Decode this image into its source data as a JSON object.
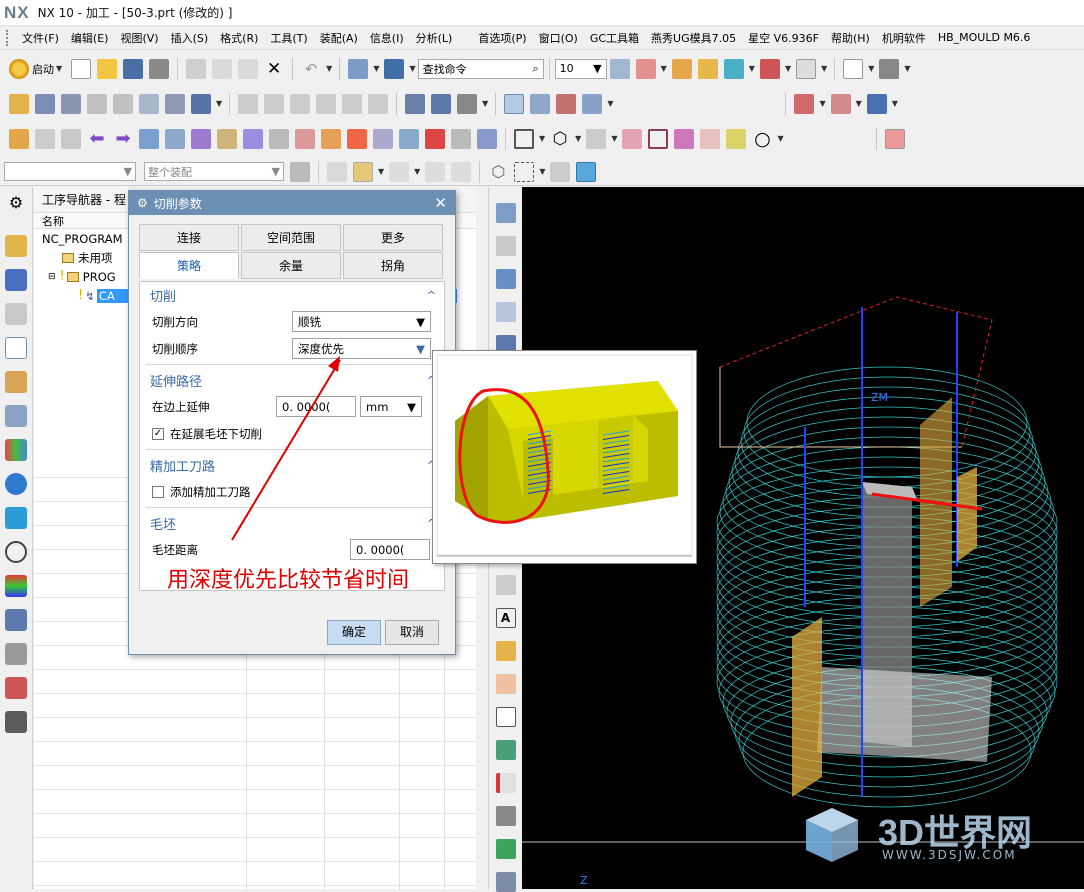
{
  "titlebar": {
    "logo": "NX",
    "title": "NX 10 - 加工 - [50-3.prt  (修改的) ]"
  },
  "menu": [
    "文件(F)",
    "编辑(E)",
    "视图(V)",
    "插入(S)",
    "格式(R)",
    "工具(T)",
    "装配(A)",
    "信息(I)",
    "分析(L)",
    "首选项(P)",
    "窗口(O)",
    "GC工具箱",
    "燕秀UG模具7.05",
    "星空 V6.936F",
    "帮助(H)",
    "机明软件",
    "HB_MOULD M6.6"
  ],
  "toolbar": {
    "start_label": "启动",
    "search_placeholder": "查找命令",
    "grid_value": "10"
  },
  "filter": {
    "assembly_placeholder": "整个装配"
  },
  "navigator": {
    "title": "工序导航器 - 程",
    "column_name": "名称",
    "rows": [
      "NC_PROGRAM",
      "未用项",
      "PROG",
      "CA"
    ]
  },
  "dialog": {
    "title": "切削参数",
    "tabs_top": [
      "连接",
      "空间范围",
      "更多"
    ],
    "tabs_bottom": [
      "策略",
      "余量",
      "拐角"
    ],
    "sections": {
      "cut": "切削",
      "extend": "延伸路径",
      "finish": "精加工刀路",
      "blank": "毛坯"
    },
    "fields": {
      "cut_direction_label": "切削方向",
      "cut_direction_value": "顺铣",
      "cut_order_label": "切削顺序",
      "cut_order_value": "深度优先",
      "extend_edge_label": "在边上延伸",
      "extend_edge_value": "0. 0000(",
      "extend_edge_unit": "mm",
      "extend_under_blank_label": "在延展毛坯下切削",
      "add_finish_label": "添加精加工刀路",
      "blank_distance_label": "毛坯距离",
      "blank_distance_value": "0. 0000("
    },
    "ok_label": "确定",
    "cancel_label": "取消"
  },
  "annotation": "用深度优先比较节省时间",
  "viewport": {
    "axis_label": "ZM",
    "axis_label2": "Z"
  },
  "watermark": {
    "brand": "3D世界网",
    "url": "WWW.3DSJW.COM"
  },
  "colors": {
    "title_blue": "#6c8fb4",
    "accent": "#3a6aa8",
    "annotation_red": "#e00000",
    "toolpath_cyan": "#3fe6ea"
  }
}
